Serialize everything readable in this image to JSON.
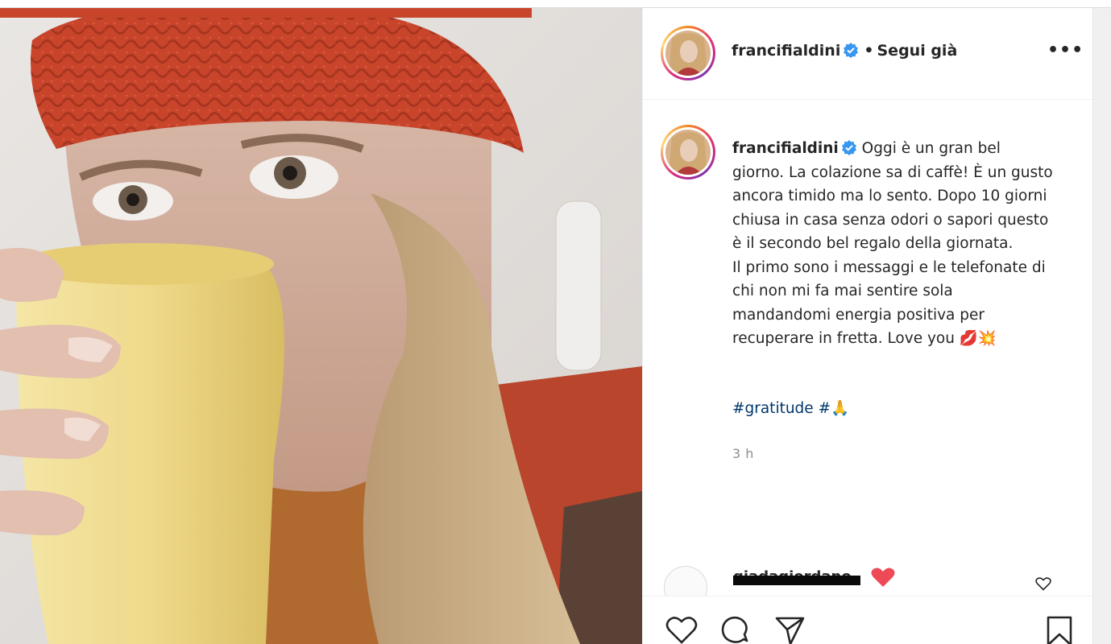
{
  "post": {
    "image_alt": "Selfie di donna con berretto rosso che beve da una tazza gialla",
    "author": "francifialdini",
    "follow_label": "Segui già",
    "follow_separator": "•",
    "more_label": "•••",
    "caption_text": "Oggi è un gran bel giorno. La colazione sa di caffè! È un gusto ancora timido ma lo sento. Dopo 10 giorni chiusa in casa senza odori o sapori questo è il secondo bel regalo della giornata.\nIl primo sono i messaggi e le telefonate di chi non mi fa mai sentire sola mandandomi energia positiva per recuperare in fretta. Love you 💋💥",
    "hashtags": [
      "#gratitude",
      "#🙏"
    ],
    "timestamp": "3 h"
  },
  "comment": {
    "username": "giadagiordano"
  },
  "actions": [
    "heart-icon",
    "comment-icon",
    "share-icon",
    "bookmark-icon"
  ],
  "colors": {
    "verified": "#3897f0",
    "link": "#00376b",
    "muted": "#8e8e8e",
    "red_heart": "#ed4956",
    "hat": "#c8452c",
    "mug": "#efd98a"
  }
}
